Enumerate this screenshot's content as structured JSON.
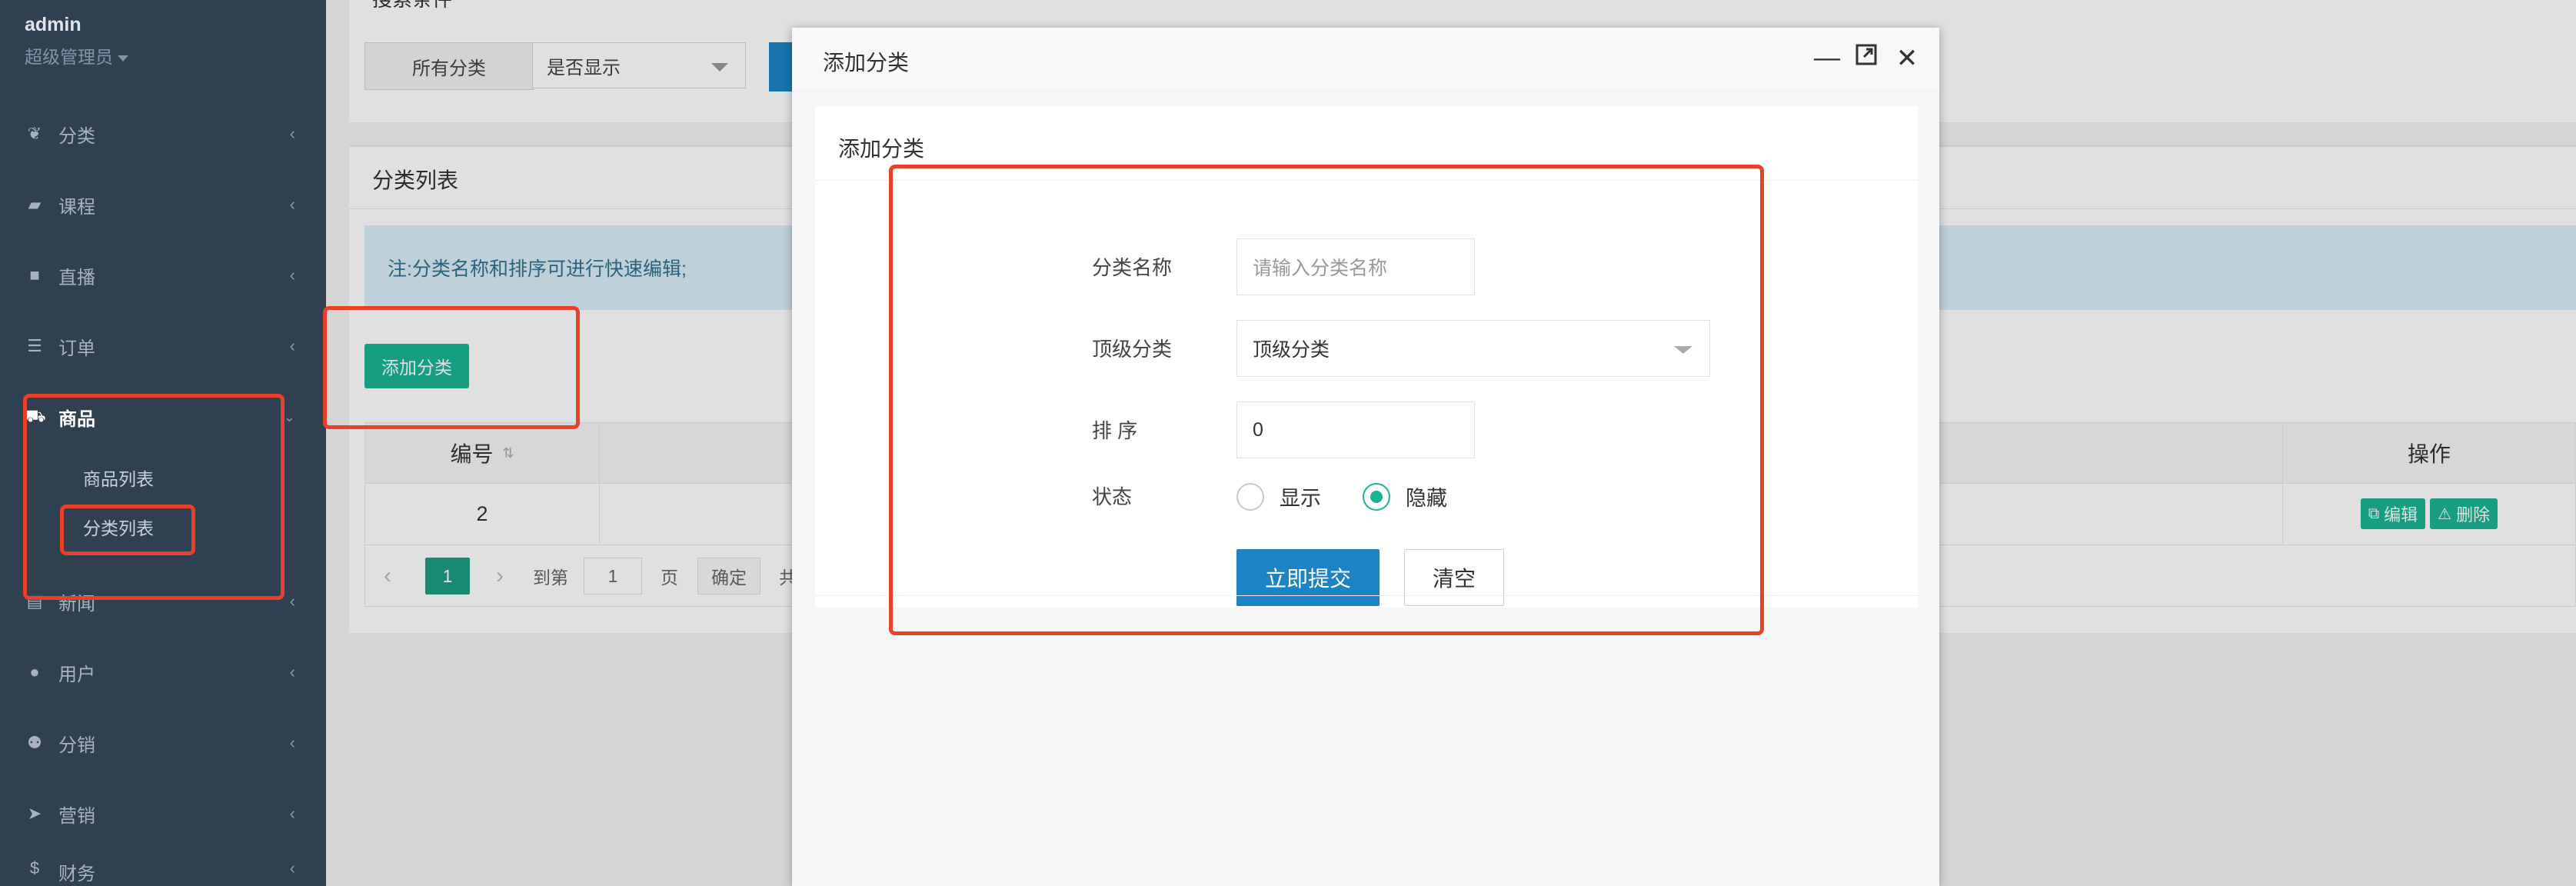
{
  "sidebar": {
    "user_name": "admin",
    "user_role": "超级管理员",
    "items": [
      {
        "label": "分类",
        "icon": "leaf-icon"
      },
      {
        "label": "课程",
        "icon": "book-icon"
      },
      {
        "label": "直播",
        "icon": "video-camera-icon"
      },
      {
        "label": "订单",
        "icon": "list-icon"
      },
      {
        "label": "商品",
        "icon": "cart-icon",
        "expanded": true,
        "children": [
          "商品列表",
          "分类列表"
        ]
      },
      {
        "label": "新闻",
        "icon": "newspaper-icon"
      },
      {
        "label": "用户",
        "icon": "user-icon"
      },
      {
        "label": "分销",
        "icon": "users-icon"
      },
      {
        "label": "营销",
        "icon": "paper-plane-icon"
      },
      {
        "label": "财务",
        "icon": "money-icon"
      }
    ]
  },
  "filter": {
    "title": "搜索条件",
    "category_select": "所有分类",
    "display_select": "是否显示"
  },
  "list": {
    "title": "分类列表",
    "notice": "注:分类名称和排序可进行快速编辑;",
    "add_button": "添加分类",
    "columns": {
      "id": "编号",
      "ops": "操作"
    },
    "rows": [
      {
        "id": "2"
      }
    ],
    "edit_button": "编辑",
    "delete_button": "删除",
    "pager": {
      "current": "1",
      "goto_label": "到第",
      "goto_value": "1",
      "page_unit": "页",
      "confirm": "确定",
      "total_prefix": "共"
    }
  },
  "modal": {
    "title": "添加分类",
    "inner_title": "添加分类",
    "fields": {
      "name_label": "分类名称",
      "name_placeholder": "请输入分类名称",
      "parent_label": "顶级分类",
      "parent_value": "顶级分类",
      "sort_label": "排 序",
      "sort_value": "0",
      "status_label": "状态",
      "status_options": [
        "显示",
        "隐藏"
      ],
      "status_selected": "隐藏"
    },
    "submit_button": "立即提交",
    "clear_button": "清空"
  },
  "annotation_color": "#e8412a"
}
